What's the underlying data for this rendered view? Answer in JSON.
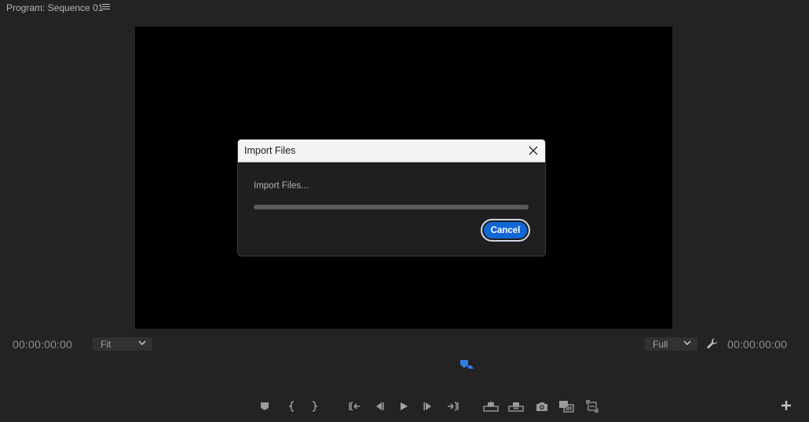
{
  "panel": {
    "title": "Program: Sequence 01",
    "menu_icon": "hamburger-menu-icon"
  },
  "monitor": {
    "timecode_left": "00:00:00:00",
    "timecode_right": "00:00:00:00",
    "zoom_select": {
      "value": "Fit"
    },
    "resolution_select": {
      "value": "Full"
    },
    "settings_icon": "wrench-icon",
    "playhead_icon": "playhead-icon"
  },
  "transport": {
    "buttons": [
      "add-marker-icon",
      "mark-in-icon",
      "mark-out-icon",
      "go-to-in-icon",
      "step-back-icon",
      "play-icon",
      "step-forward-icon",
      "go-to-out-icon",
      "lift-icon",
      "extract-icon",
      "export-frame-icon",
      "insert-icon",
      "overwrite-icon"
    ],
    "add_button_icon": "plus-icon"
  },
  "dialog": {
    "title": "Import Files",
    "message": "Import Files...",
    "progress": 0,
    "cancel_label": "Cancel",
    "accent_color": "#1267d6"
  }
}
